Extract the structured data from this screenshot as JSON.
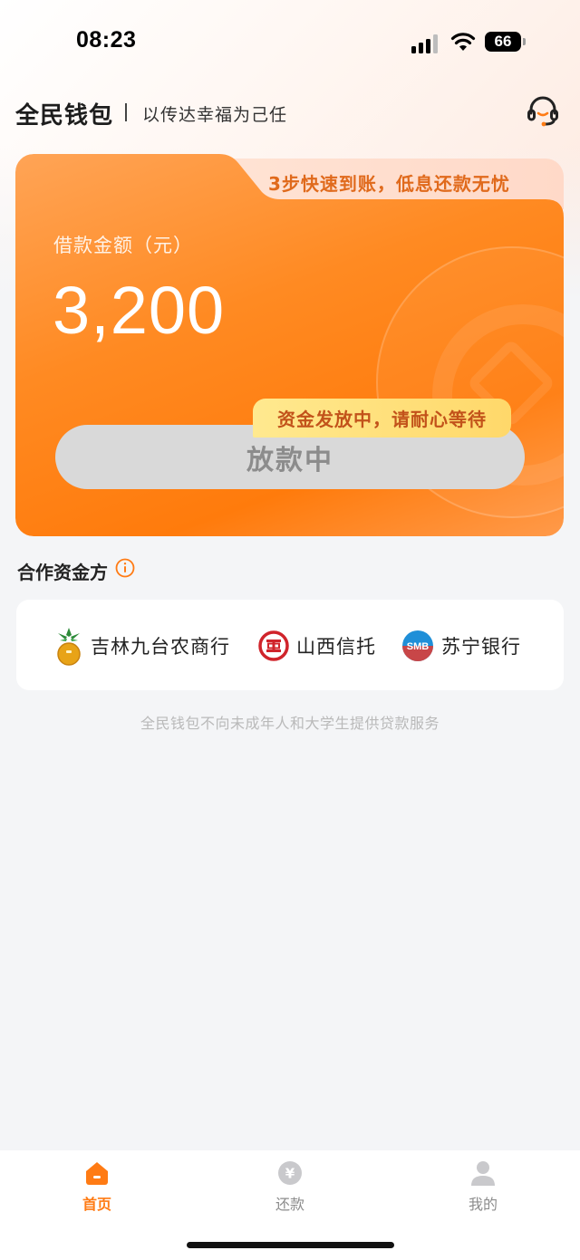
{
  "status_bar": {
    "time": "08:23",
    "battery": "66"
  },
  "header": {
    "brand": "全民钱包",
    "slogan": "以传达幸福为己任",
    "support_icon": "headset-icon"
  },
  "loan_card": {
    "tab_text": "3步快速到账，低息还款无忧",
    "amount_label": "借款金额（元）",
    "amount": "3,200",
    "button_label": "放款中",
    "tip": "资金发放中，请耐心等待"
  },
  "partners": {
    "title": "合作资金方",
    "items": [
      {
        "name": "吉林九台农商行",
        "icon": "jilin-jiutai-logo-icon"
      },
      {
        "name": "山西信托",
        "icon": "shanxi-trust-logo-icon"
      },
      {
        "name": "苏宁银行",
        "icon": "smb-logo-icon",
        "icon_text": "SMB"
      }
    ]
  },
  "disclaimer": "全民钱包不向未成年人和大学生提供贷款服务",
  "tabs": [
    {
      "label": "首页",
      "icon": "home-icon",
      "active": true
    },
    {
      "label": "还款",
      "icon": "repay-icon",
      "icon_text": "¥",
      "active": false
    },
    {
      "label": "我的",
      "icon": "user-icon",
      "active": false
    }
  ],
  "colors": {
    "accent": "#ff7b14",
    "card_start": "#ffa456",
    "card_end": "#ff7b0c",
    "tip_bg": "#ffdf7a",
    "button_disabled": "#d9d9d9"
  }
}
